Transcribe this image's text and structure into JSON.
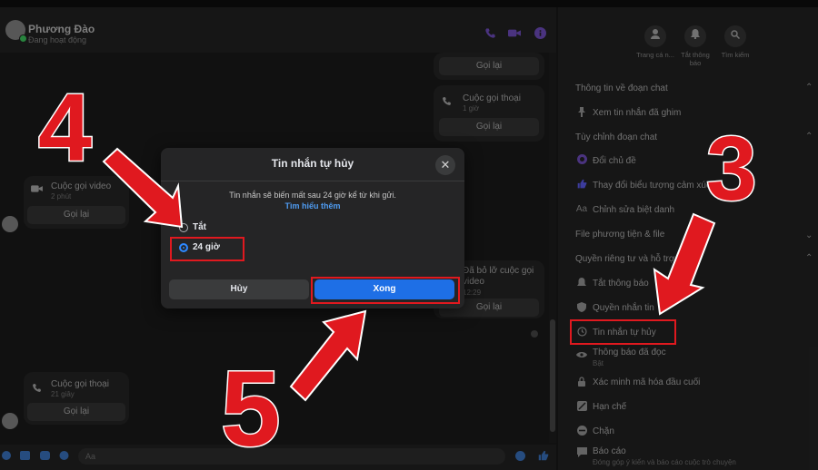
{
  "chat": {
    "contact_name": "Phương Đào",
    "status": "Đang hoạt động",
    "composer_placeholder": "Aa"
  },
  "messages": [
    {
      "title": "",
      "time": "",
      "callback": "Gọi lại"
    },
    {
      "title": "Cuộc gọi thoại",
      "time": "1 giờ",
      "callback": "Gọi lại"
    },
    {
      "title": "Cuộc gọi video",
      "time": "2 phút",
      "callback": "Gọi lại"
    },
    {
      "title": "Đã bỏ lỡ cuộc gọi video",
      "time": "12:29",
      "callback": "Gọi lại"
    },
    {
      "title": "Cuộc gọi thoại",
      "time": "21 giây",
      "callback": "Gọi lại"
    }
  ],
  "right_panel": {
    "top_buttons": [
      {
        "label": "Trang cá n...",
        "icon": "profile-icon"
      },
      {
        "label": "Tắt thông báo",
        "icon": "bell-icon"
      },
      {
        "label": "Tìm kiếm",
        "icon": "search-icon"
      }
    ],
    "sections": [
      {
        "title": "Thông tin về đoạn chat"
      },
      {
        "title": "Tùy chỉnh đoạn chat"
      },
      {
        "title": "File phương tiện & file"
      },
      {
        "title": "Quyền riêng tư và hỗ trợ"
      }
    ],
    "items": {
      "pinned": "Xem tin nhắn đã ghim",
      "theme": "Đổi chủ đề",
      "emoji": "Thay đổi biểu tượng cảm xúc",
      "nickname": "Chỉnh sửa biệt danh",
      "mute": "Tắt thông báo",
      "message_perm": "Quyền nhắn tin",
      "vanish": "Tin nhắn tự hủy",
      "read_receipts": "Thông báo đã đọc",
      "read_receipts_sub": "Bật",
      "e2ee": "Xác minh mã hóa đầu cuối",
      "restrict": "Hạn chế",
      "block": "Chặn",
      "report": "Báo cáo",
      "report_sub": "Đóng góp ý kiến và báo cáo cuộc trò chuyện"
    }
  },
  "modal": {
    "title": "Tin nhắn tự hủy",
    "description": "Tin nhắn sẽ biến mất sau 24 giờ kể từ khi gửi.",
    "learn_more": "Tìm hiểu thêm",
    "options": [
      {
        "label": "Tắt",
        "selected": false
      },
      {
        "label": "24 giờ",
        "selected": true
      }
    ],
    "cancel_label": "Hủy",
    "done_label": "Xong"
  },
  "annotations": {
    "step3": "3",
    "step4": "4",
    "step5": "5"
  },
  "colors": {
    "accent": "#1e6fe6",
    "annotation_red": "#e0191f",
    "modal_bg": "#252526"
  }
}
